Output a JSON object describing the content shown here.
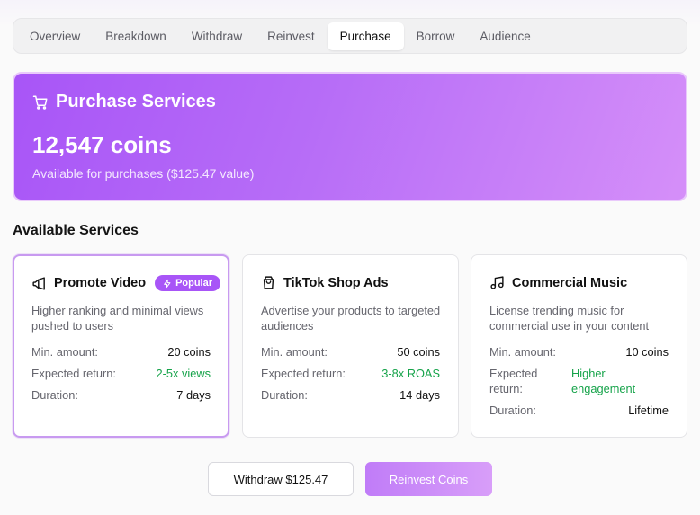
{
  "tabs": [
    {
      "label": "Overview"
    },
    {
      "label": "Breakdown"
    },
    {
      "label": "Withdraw"
    },
    {
      "label": "Reinvest"
    },
    {
      "label": "Purchase",
      "active": true
    },
    {
      "label": "Borrow"
    },
    {
      "label": "Audience"
    }
  ],
  "hero": {
    "icon": "shopping-cart-icon",
    "title": "Purchase Services",
    "amount": "12,547 coins",
    "subtitle": "Available for purchases ($125.47 value)"
  },
  "section_title": "Available Services",
  "services": [
    {
      "icon": "megaphone-icon",
      "title": "Promote Video",
      "badge": "Popular",
      "badge_icon": "lightning-icon",
      "description": "Higher ranking and minimal views pushed to users",
      "min_label": "Min. amount:",
      "min_value": "20 coins",
      "return_label": "Expected return:",
      "return_value": "2-5x views",
      "duration_label": "Duration:",
      "duration_value": "7 days",
      "selected": true
    },
    {
      "icon": "shopping-bag-icon",
      "title": "TikTok Shop Ads",
      "description": "Advertise your products to targeted audiences",
      "min_label": "Min. amount:",
      "min_value": "50 coins",
      "return_label": "Expected return:",
      "return_value": "3-8x ROAS",
      "duration_label": "Duration:",
      "duration_value": "14 days"
    },
    {
      "icon": "music-note-icon",
      "title": "Commercial Music",
      "description": "License trending music for commercial use in your content",
      "min_label": "Min. amount:",
      "min_value": "10 coins",
      "return_label": "Expected return:",
      "return_value": "Higher engagement",
      "duration_label": "Duration:",
      "duration_value": "Lifetime"
    }
  ],
  "actions": {
    "withdraw_label": "Withdraw $125.47",
    "reinvest_label": "Reinvest Coins"
  },
  "colors": {
    "accent": "#a855f7",
    "accent_light": "#d58ff9",
    "positive": "#16a34a"
  }
}
